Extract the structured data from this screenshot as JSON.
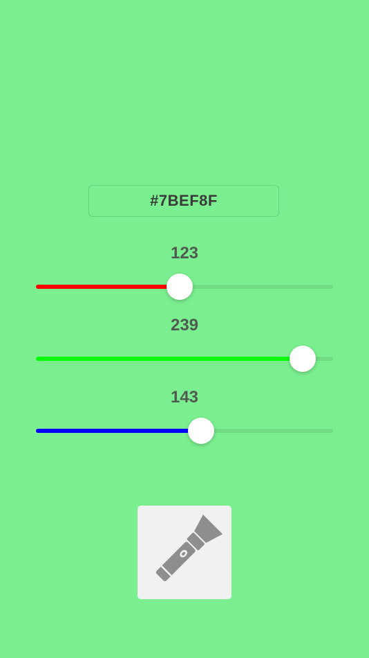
{
  "color": {
    "hex_label": "#7BEF8F",
    "background": "#7BEF8F"
  },
  "sliders": [
    {
      "id": "red",
      "value": 123,
      "label": "123",
      "max": 255,
      "fill_color": "#ff0000"
    },
    {
      "id": "green",
      "value": 239,
      "label": "239",
      "max": 255,
      "fill_color": "#00ff00"
    },
    {
      "id": "blue",
      "value": 143,
      "label": "143",
      "max": 255,
      "fill_color": "#0000ff"
    }
  ],
  "flashlight_button": {
    "icon": "flashlight-icon"
  }
}
